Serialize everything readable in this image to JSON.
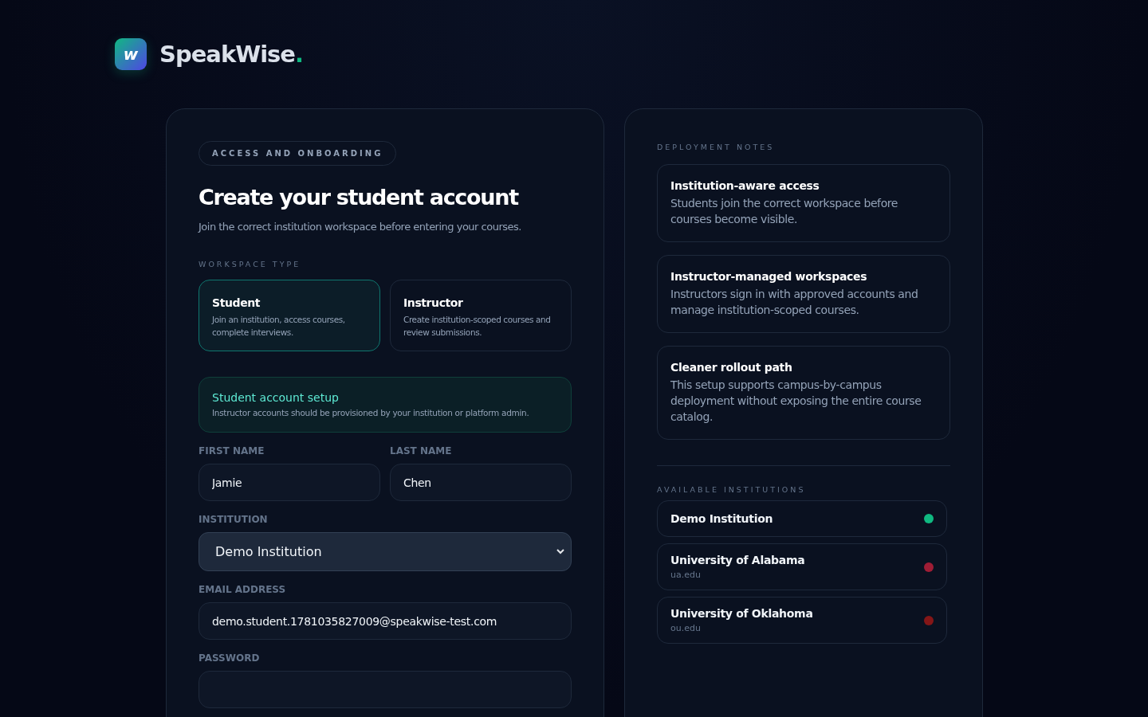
{
  "brand": {
    "logo_letter": "w",
    "name": "SpeakWise",
    "dot": "."
  },
  "form": {
    "eyebrow": "ACCESS AND ONBOARDING",
    "title": "Create your student account",
    "subtitle": "Join the correct institution workspace before entering your courses.",
    "workspace_label": "WORKSPACE TYPE",
    "workspace_types": [
      {
        "title": "Student",
        "description": "Join an institution, access courses, complete interviews.",
        "selected": true
      },
      {
        "title": "Instructor",
        "description": "Create institution-scoped courses and review submissions.",
        "selected": false
      }
    ],
    "notice": {
      "title": "Student account setup",
      "text": "Instructor accounts should be provisioned by your institution or platform admin."
    },
    "first_name": {
      "label": "FIRST NAME",
      "value": "Jamie"
    },
    "last_name": {
      "label": "LAST NAME",
      "value": "Chen"
    },
    "institution": {
      "label": "INSTITUTION",
      "value": "Demo Institution"
    },
    "email": {
      "label": "EMAIL ADDRESS",
      "value": "demo.student.1781035827009@speakwise-test.com"
    },
    "password": {
      "label": "PASSWORD"
    }
  },
  "side": {
    "notes_label": "DEPLOYMENT NOTES",
    "notes": [
      {
        "title": "Institution-aware access",
        "text": "Students join the correct workspace before courses become visible."
      },
      {
        "title": "Instructor-managed workspaces",
        "text": "Instructors sign in with approved accounts and manage institution-scoped courses."
      },
      {
        "title": "Cleaner rollout path",
        "text": "This setup supports campus-by-campus deployment without exposing the entire course catalog."
      }
    ],
    "institutions_label": "AVAILABLE INSTITUTIONS",
    "institutions": [
      {
        "name": "Demo Institution",
        "color": "#10b981"
      },
      {
        "name": "University of Alabama",
        "domain": "ua.edu",
        "color": "#9f1d35"
      },
      {
        "name": "University of Oklahoma",
        "domain": "ou.edu",
        "color": "#841617"
      }
    ]
  }
}
